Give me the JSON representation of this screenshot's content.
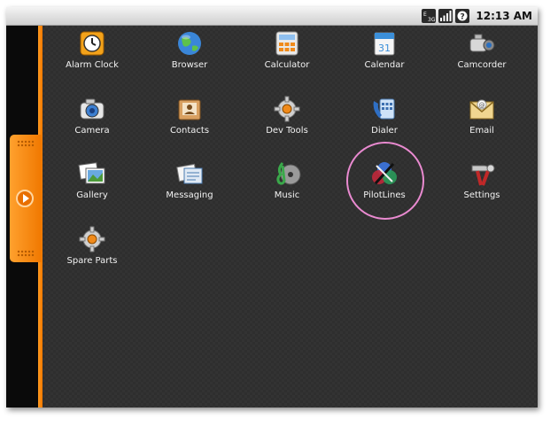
{
  "status_bar": {
    "time": "12:13 AM",
    "icons": [
      "network-3g-icon",
      "signal-icon",
      "battery-alert-icon"
    ]
  },
  "apps": [
    {
      "label": "Alarm Clock",
      "icon": "alarm-clock-icon"
    },
    {
      "label": "Browser",
      "icon": "globe-icon"
    },
    {
      "label": "Calculator",
      "icon": "calculator-icon"
    },
    {
      "label": "Calendar",
      "icon": "calendar-icon"
    },
    {
      "label": "Camcorder",
      "icon": "camcorder-icon"
    },
    {
      "label": "Camera",
      "icon": "camera-icon"
    },
    {
      "label": "Contacts",
      "icon": "contacts-icon"
    },
    {
      "label": "Dev Tools",
      "icon": "gear-icon"
    },
    {
      "label": "Dialer",
      "icon": "phone-icon"
    },
    {
      "label": "Email",
      "icon": "email-icon"
    },
    {
      "label": "Gallery",
      "icon": "gallery-icon"
    },
    {
      "label": "Messaging",
      "icon": "messaging-icon"
    },
    {
      "label": "Music",
      "icon": "music-icon"
    },
    {
      "label": "PilotLines",
      "icon": "pilotlines-icon"
    },
    {
      "label": "Settings",
      "icon": "settings-icon"
    },
    {
      "label": "Spare Parts",
      "icon": "spare-parts-icon"
    }
  ],
  "calendar_day": "31",
  "highlighted_app": "PilotLines",
  "colors": {
    "accent": "#f07800",
    "highlight_ring": "#e98ad0",
    "background": "#2e2e2e"
  }
}
